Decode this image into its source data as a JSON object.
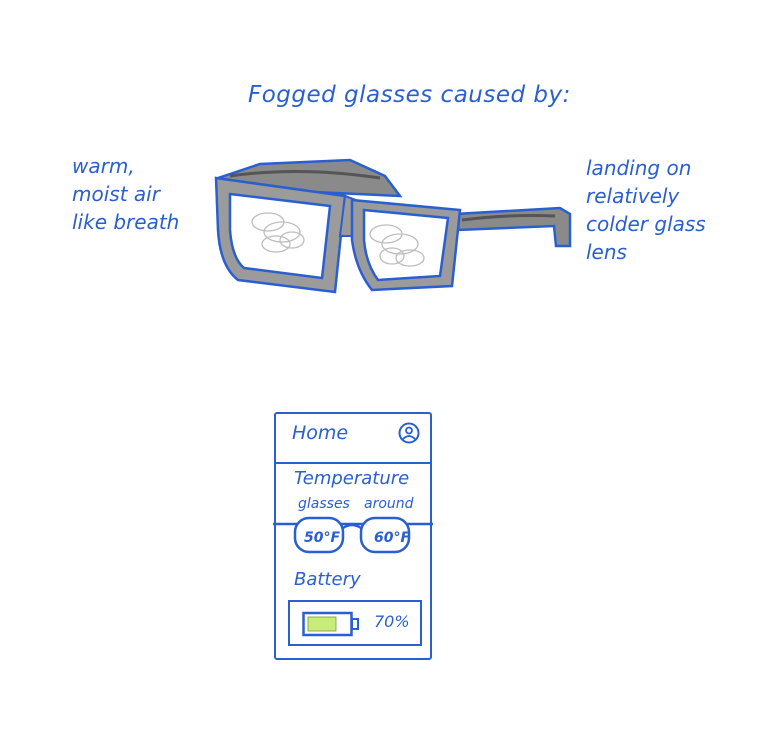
{
  "title": "Fogged glasses caused by:",
  "notes": {
    "left": [
      "warm,",
      "moist air",
      "like breath"
    ],
    "right": [
      "landing on",
      "relatively",
      "colder glass",
      "lens"
    ]
  },
  "phone": {
    "header": {
      "title": "Home",
      "account_icon": "account-circle-icon"
    },
    "temperature": {
      "heading": "Temperature",
      "glasses_label": "glasses",
      "around_label": "around",
      "glasses_value": "50°F",
      "around_value": "60°F"
    },
    "battery": {
      "heading": "Battery",
      "percent_text": "70%",
      "level": 0.7,
      "fill_color": "#c8ec7a"
    }
  },
  "colors": {
    "ink": "#2a5fd0",
    "frame_pattern": "#7f7f7f",
    "fog": "#bdbdbd"
  }
}
